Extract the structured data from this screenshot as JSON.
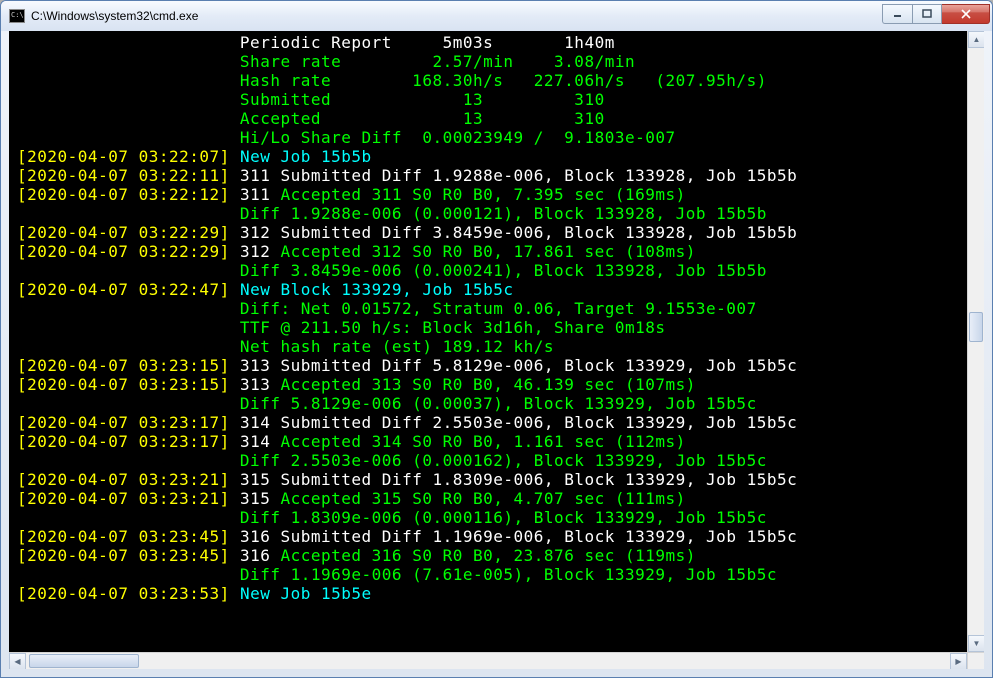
{
  "window": {
    "title": "C:\\Windows\\system32\\cmd.exe"
  },
  "report": {
    "header": "Periodic Report     5m03s       1h40m",
    "share_rate": "Share rate         2.57/min    3.08/min",
    "hash_rate": "Hash rate        168.30h/s   227.06h/s   (207.95h/s)",
    "submitted": "Submitted             13         310",
    "accepted": "Accepted              13         310",
    "hilo": "Hi/Lo Share Diff  0.00023949 /  9.1803e-007"
  },
  "lines": [
    {
      "ts": "[2020-04-07 03:22:07]",
      "segs": [
        [
          "c",
          "New Job 15b5b"
        ]
      ]
    },
    {
      "ts": "[2020-04-07 03:22:11]",
      "segs": [
        [
          "w",
          "311 Submitted Diff 1.9288e-006, Block 133928, Job 15b5b"
        ]
      ]
    },
    {
      "ts": "[2020-04-07 03:22:12]",
      "segs": [
        [
          "w",
          "311 "
        ],
        [
          "g",
          "Accepted 311 S0 R0 B0, 7.395 sec (169ms)"
        ]
      ]
    },
    {
      "ts": "",
      "segs": [
        [
          "g",
          "Diff 1.9288e-006 (0.000121), Block 133928, Job 15b5b"
        ]
      ]
    },
    {
      "ts": "[2020-04-07 03:22:29]",
      "segs": [
        [
          "w",
          "312 Submitted Diff 3.8459e-006, Block 133928, Job 15b5b"
        ]
      ]
    },
    {
      "ts": "[2020-04-07 03:22:29]",
      "segs": [
        [
          "w",
          "312 "
        ],
        [
          "g",
          "Accepted 312 S0 R0 B0, 17.861 sec (108ms)"
        ]
      ]
    },
    {
      "ts": "",
      "segs": [
        [
          "g",
          "Diff 3.8459e-006 (0.000241), Block 133928, Job 15b5b"
        ]
      ]
    },
    {
      "ts": "[2020-04-07 03:22:47]",
      "segs": [
        [
          "c",
          "New Block 133929, Job 15b5c"
        ]
      ]
    },
    {
      "ts": "",
      "segs": [
        [
          "g",
          "Diff: Net 0.01572, Stratum 0.06, Target 9.1553e-007"
        ]
      ]
    },
    {
      "ts": "",
      "segs": [
        [
          "g",
          "TTF @ 211.50 h/s: Block 3d16h, Share 0m18s"
        ]
      ]
    },
    {
      "ts": "",
      "segs": [
        [
          "g",
          "Net hash rate (est) 189.12 kh/s"
        ]
      ]
    },
    {
      "ts": "[2020-04-07 03:23:15]",
      "segs": [
        [
          "w",
          "313 Submitted Diff 5.8129e-006, Block 133929, Job 15b5c"
        ]
      ]
    },
    {
      "ts": "[2020-04-07 03:23:15]",
      "segs": [
        [
          "w",
          "313 "
        ],
        [
          "g",
          "Accepted 313 S0 R0 B0, 46.139 sec (107ms)"
        ]
      ]
    },
    {
      "ts": "",
      "segs": [
        [
          "g",
          "Diff 5.8129e-006 (0.00037), Block 133929, Job 15b5c"
        ]
      ]
    },
    {
      "ts": "[2020-04-07 03:23:17]",
      "segs": [
        [
          "w",
          "314 Submitted Diff 2.5503e-006, Block 133929, Job 15b5c"
        ]
      ]
    },
    {
      "ts": "[2020-04-07 03:23:17]",
      "segs": [
        [
          "w",
          "314 "
        ],
        [
          "g",
          "Accepted 314 S0 R0 B0, 1.161 sec (112ms)"
        ]
      ]
    },
    {
      "ts": "",
      "segs": [
        [
          "g",
          "Diff 2.5503e-006 (0.000162), Block 133929, Job 15b5c"
        ]
      ]
    },
    {
      "ts": "[2020-04-07 03:23:21]",
      "segs": [
        [
          "w",
          "315 Submitted Diff 1.8309e-006, Block 133929, Job 15b5c"
        ]
      ]
    },
    {
      "ts": "[2020-04-07 03:23:21]",
      "segs": [
        [
          "w",
          "315 "
        ],
        [
          "g",
          "Accepted 315 S0 R0 B0, 4.707 sec (111ms)"
        ]
      ]
    },
    {
      "ts": "",
      "segs": [
        [
          "g",
          "Diff 1.8309e-006 (0.000116), Block 133929, Job 15b5c"
        ]
      ]
    },
    {
      "ts": "[2020-04-07 03:23:45]",
      "segs": [
        [
          "w",
          "316 Submitted Diff 1.1969e-006, Block 133929, Job 15b5c"
        ]
      ]
    },
    {
      "ts": "[2020-04-07 03:23:45]",
      "segs": [
        [
          "w",
          "316 "
        ],
        [
          "g",
          "Accepted 316 S0 R0 B0, 23.876 sec (119ms)"
        ]
      ]
    },
    {
      "ts": "",
      "segs": [
        [
          "g",
          "Diff 1.1969e-006 (7.61e-005), Block 133929, Job 15b5c"
        ]
      ]
    },
    {
      "ts": "[2020-04-07 03:23:53]",
      "segs": [
        [
          "c",
          "New Job 15b5e"
        ]
      ]
    }
  ]
}
